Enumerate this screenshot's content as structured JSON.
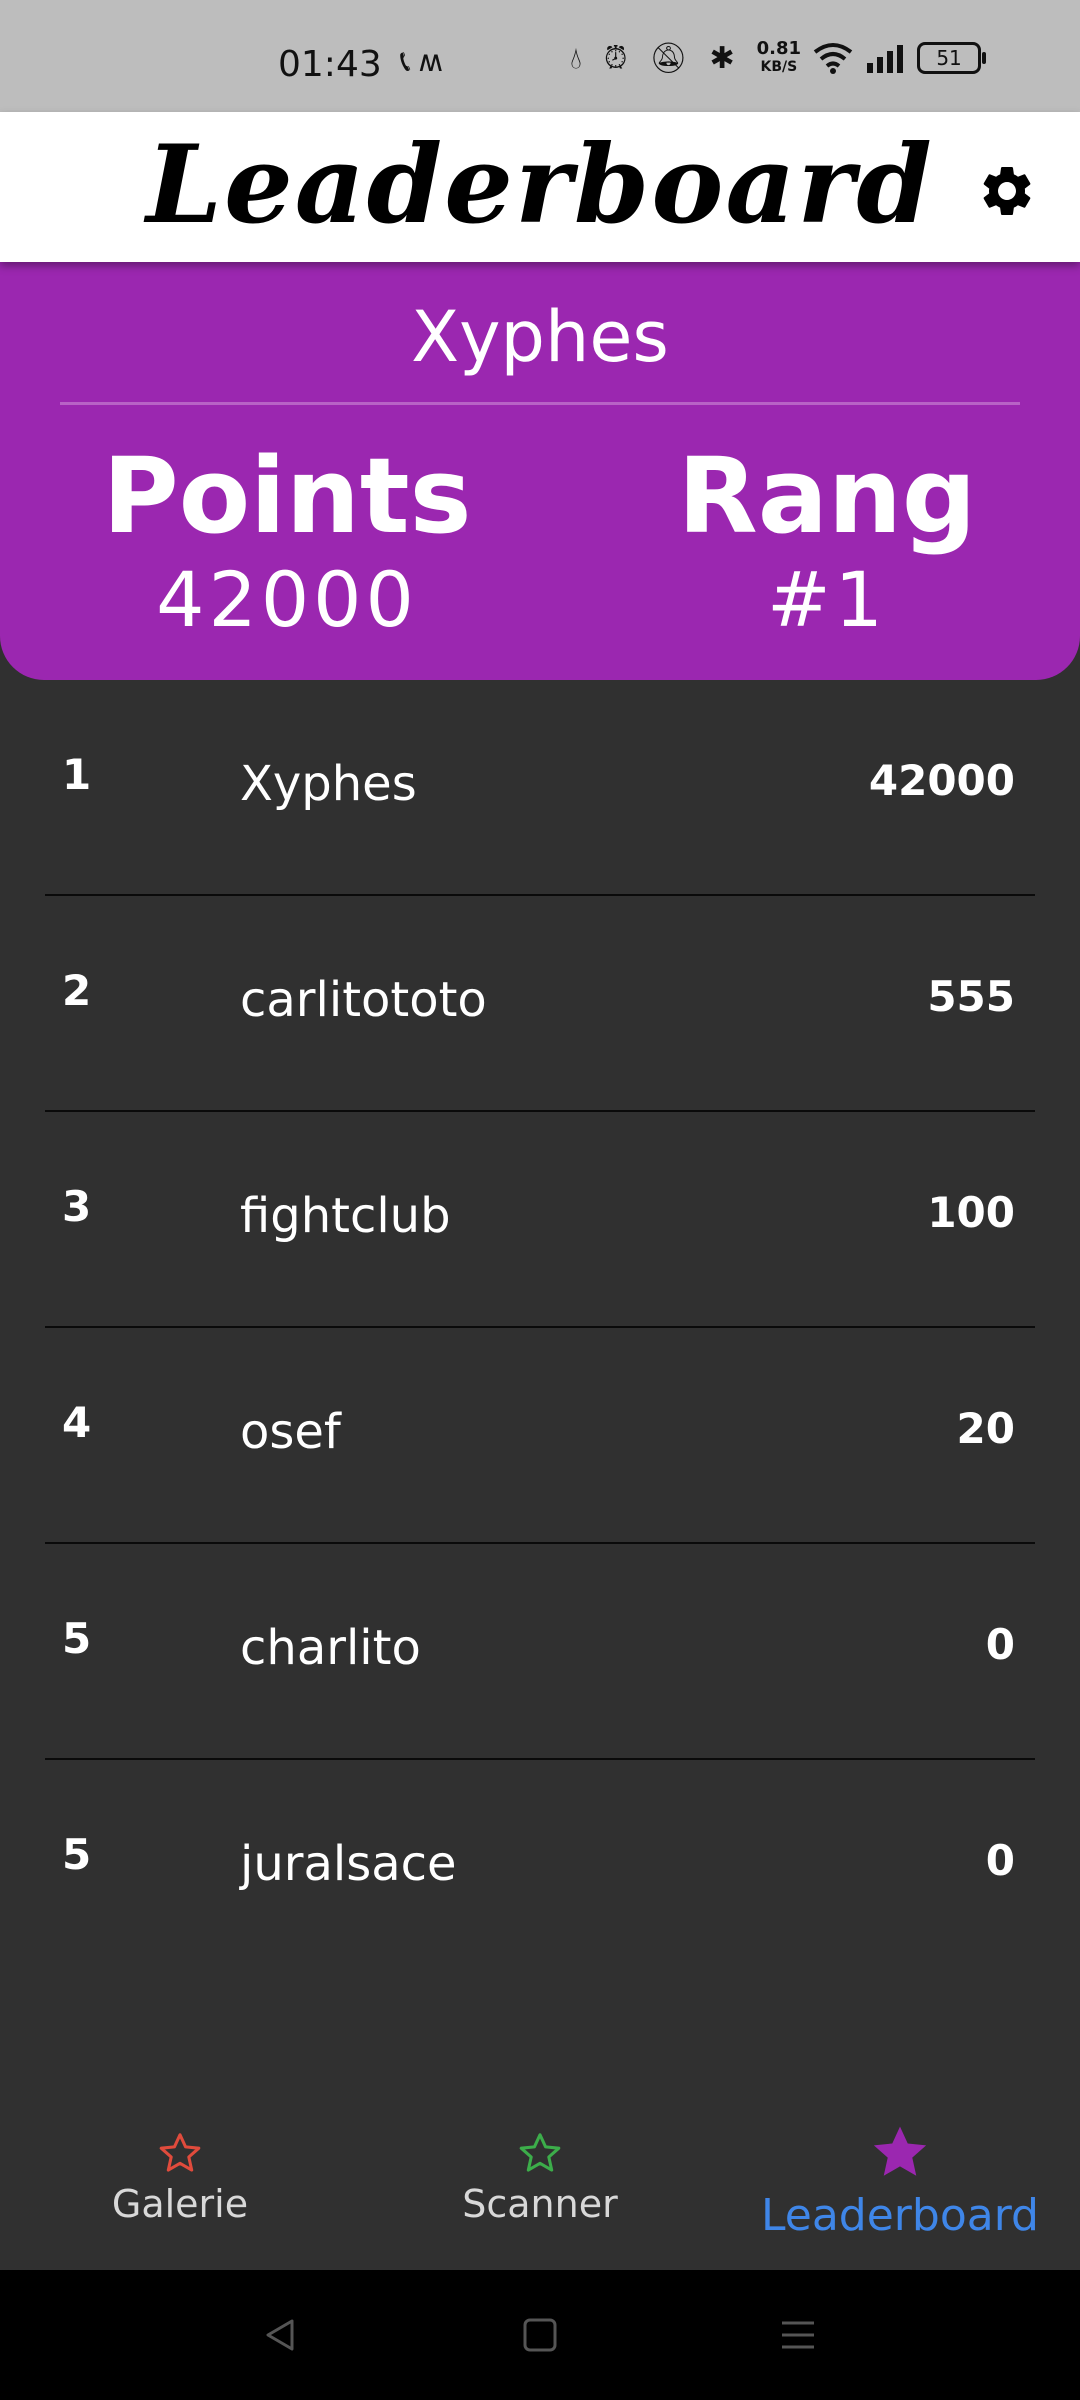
{
  "status_bar": {
    "time": "01:43",
    "speed_value": "0.81",
    "speed_unit": "KB/S",
    "battery": "51"
  },
  "header": {
    "title": "Leaderboard",
    "settings_icon": "gear-icon"
  },
  "profile": {
    "name": "Xyphes",
    "points_label": "Points",
    "points_value": "42000",
    "rank_label": "Rang",
    "rank_value": "#1",
    "color": "#9b27b0"
  },
  "leaderboard": {
    "rows": [
      {
        "rank": "1",
        "name": "Xyphes",
        "points": "42000"
      },
      {
        "rank": "2",
        "name": "carlitototo",
        "points": "555"
      },
      {
        "rank": "3",
        "name": "fightclub",
        "points": "100"
      },
      {
        "rank": "4",
        "name": "osef",
        "points": "20"
      },
      {
        "rank": "5",
        "name": "charlito",
        "points": "0"
      },
      {
        "rank": "5",
        "name": "juralsace",
        "points": "0"
      }
    ]
  },
  "bottom_nav": {
    "items": [
      {
        "label": "Galerie",
        "icon": "star-outline-icon",
        "color": "#e04b3c"
      },
      {
        "label": "Scanner",
        "icon": "star-outline-icon",
        "color": "#3cad4a"
      },
      {
        "label": "Leaderboard",
        "icon": "star-filled-icon",
        "color": "#9b27b0",
        "active": true
      }
    ],
    "active_color": "#3f86e8"
  }
}
